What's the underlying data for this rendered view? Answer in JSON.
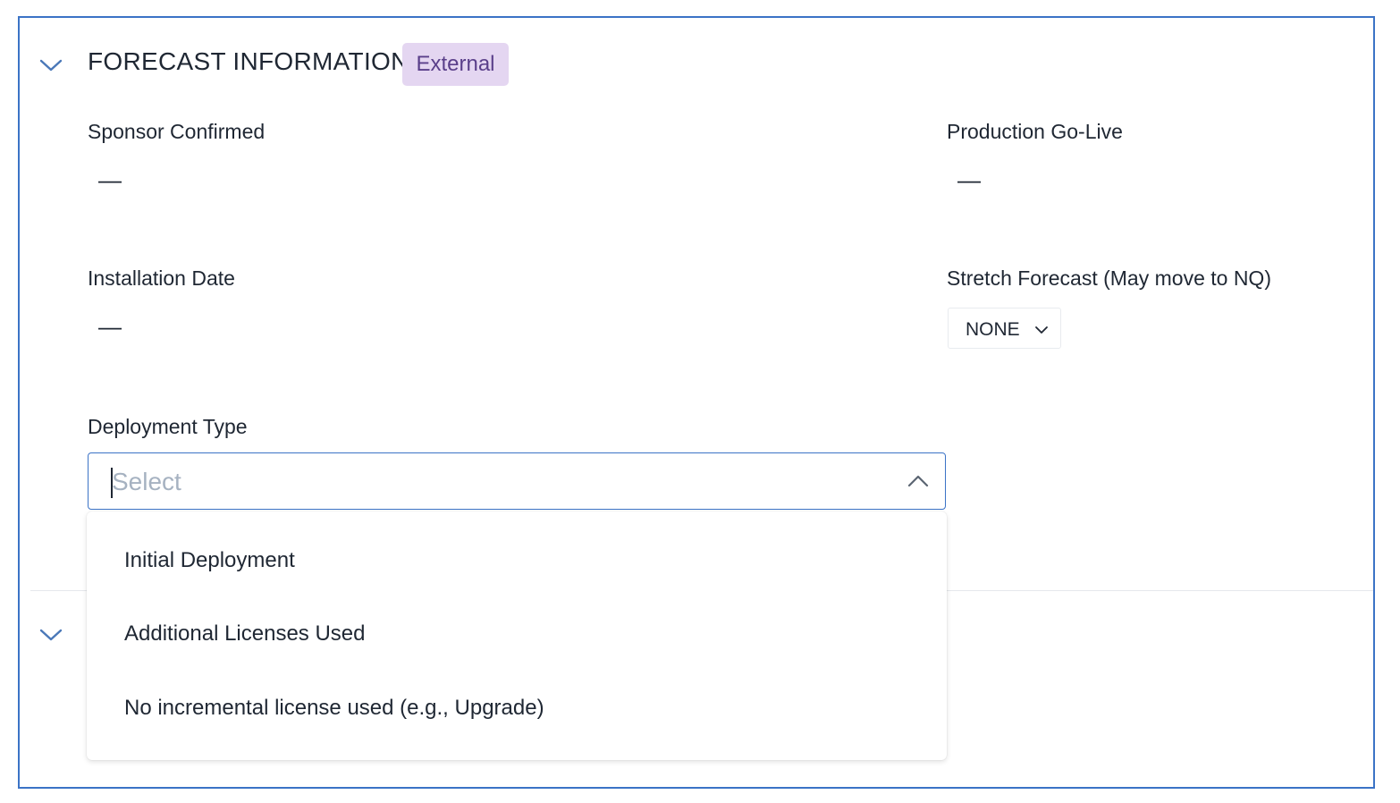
{
  "section": {
    "title": "FORECAST INFORMATION",
    "badge": "External",
    "expand_icon": "chevron-down-icon"
  },
  "fields": {
    "sponsor_confirmed": {
      "label": "Sponsor Confirmed",
      "value": "—"
    },
    "production_go_live": {
      "label": "Production Go-Live",
      "value": "—"
    },
    "installation_date": {
      "label": "Installation Date",
      "value": "—"
    },
    "stretch_forecast": {
      "label": "Stretch Forecast (May move to NQ)",
      "value": "NONE",
      "caret_icon": "chevron-down-icon"
    },
    "deployment_type": {
      "label": "Deployment Type",
      "placeholder": "Select",
      "toggle_icon": "chevron-up-icon",
      "options": [
        "Initial Deployment",
        "Additional Licenses Used",
        "No incremental license used (e.g., Upgrade)"
      ]
    }
  },
  "next_section": {
    "expand_icon": "chevron-down-icon"
  },
  "colors": {
    "frame_border": "#3b73c6",
    "badge_bg": "#e4d6f1",
    "badge_text": "#5a3f8a",
    "chevron": "#4a78b8",
    "placeholder": "#a6b2c1"
  }
}
